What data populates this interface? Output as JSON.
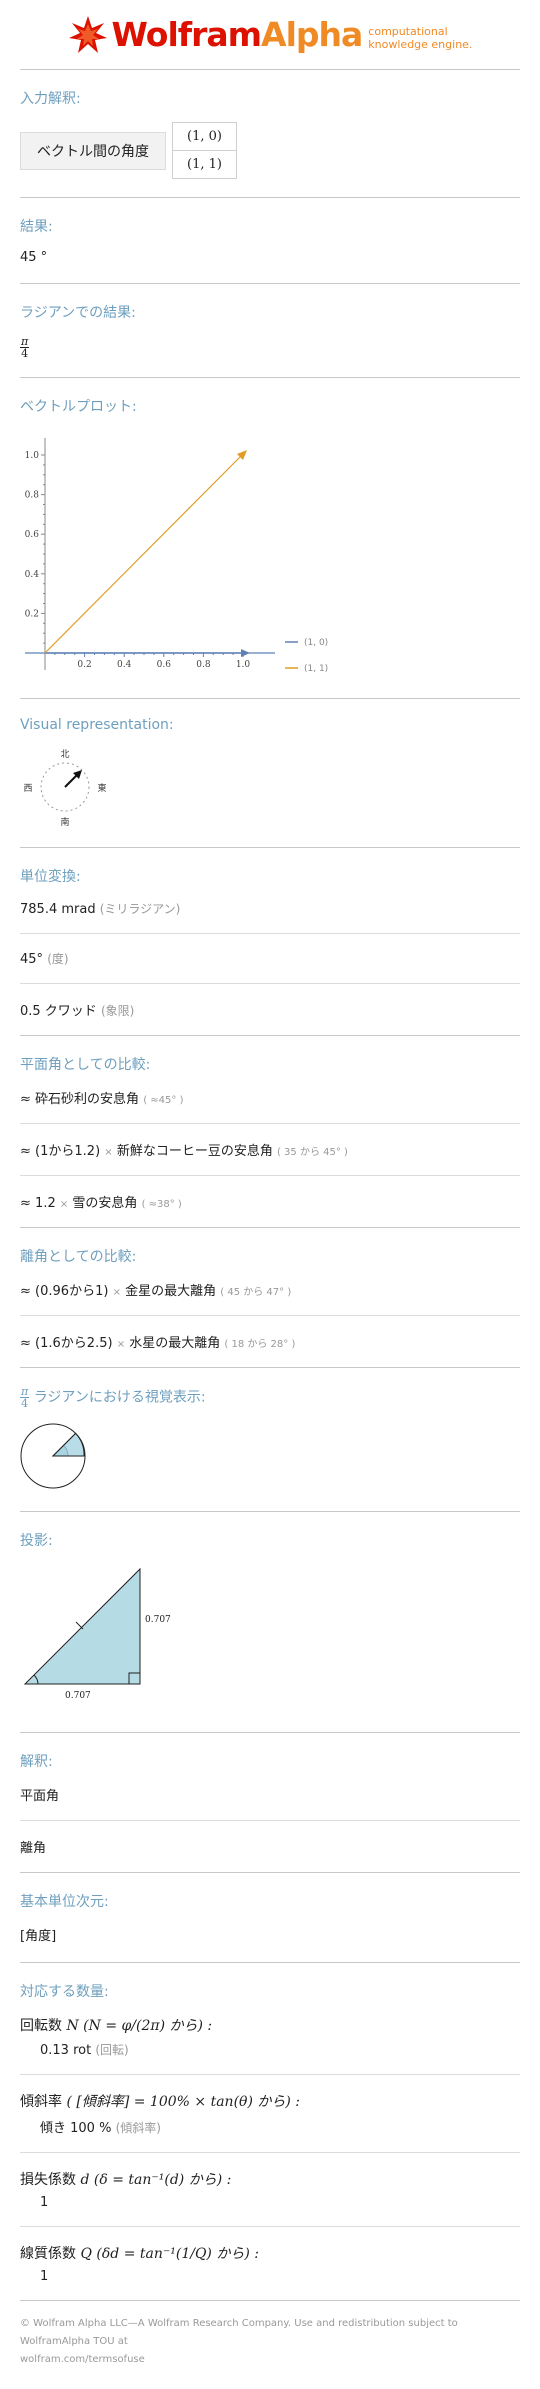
{
  "logo": {
    "word1": "Wolfram",
    "word2": "Alpha",
    "tagline1": "computational",
    "tagline2": "knowledge engine."
  },
  "input": {
    "title": "入力解釈:",
    "label": "ベクトル間の角度",
    "vec1": "(1, 0)",
    "vec2": "(1, 1)"
  },
  "result": {
    "title": "結果:",
    "value": "45 °"
  },
  "radian": {
    "title": "ラジアンでの結果:",
    "num": "π",
    "den": "4"
  },
  "plot": {
    "title": "ベクトルプロット:",
    "legend": [
      "(1, 0)",
      "(1, 1)"
    ],
    "colors": {
      "v1": "#5e81b5",
      "v2": "#e19c24"
    },
    "xticks": [
      "0.2",
      "0.4",
      "0.6",
      "0.8",
      "1.0"
    ],
    "yticks": [
      "0.2",
      "0.4",
      "0.6",
      "0.8",
      "1.0"
    ]
  },
  "visual": {
    "title": "Visual representation:",
    "north": "北",
    "south": "南",
    "east": "東",
    "west": "西"
  },
  "units": {
    "title": "単位変換:",
    "rows": [
      {
        "value": "785.4 mrad",
        "note": "(ミリラジアン)"
      },
      {
        "value": "45°",
        "note": "(度)"
      },
      {
        "value": "0.5 クワッド",
        "note": "(象限)"
      }
    ]
  },
  "planar": {
    "title": "平面角としての比較:",
    "r1": {
      "pre": "≈",
      "text": "砕石砂利の安息角",
      "note": "( ≈45° )"
    },
    "r2": {
      "pre": "≈",
      "range": "(1から1.2)",
      "times": "×",
      "text": "新鮮なコーヒー豆の安息角",
      "note": "( 35 から 45° )"
    },
    "r3": {
      "pre": "≈",
      "num": "1.2",
      "times": "×",
      "text": "雪の安息角",
      "note": "( ≈38° )"
    }
  },
  "elong": {
    "title": "離角としての比較:",
    "r1": {
      "pre": "≈",
      "range": "(0.96から1)",
      "times": "×",
      "text": "金星の最大離角",
      "note": "( 45 から 47° )"
    },
    "r2": {
      "pre": "≈",
      "range": "(1.6から2.5)",
      "times": "×",
      "text": "水星の最大離角",
      "note": "( 18 から 28° )"
    }
  },
  "radvis": {
    "num": "π",
    "den": "4",
    "title": "ラジアンにおける視覚表示:"
  },
  "projection": {
    "title": "投影:",
    "side1": "0.707",
    "side2": "0.707"
  },
  "interp": {
    "title": "解釈:",
    "items": [
      "平面角",
      "離角"
    ]
  },
  "basic": {
    "title": "基本単位次元:",
    "value": "[角度]"
  },
  "corr": {
    "title": "対応する数量:",
    "q1": {
      "label": "回転数",
      "var": "N",
      "formula": "(N = φ/(2π) から) :",
      "value": "0.13 rot",
      "note": "(回転)"
    },
    "q2": {
      "label": "傾斜率",
      "formula": "( [傾斜率] = 100% × tan(θ) から) :",
      "value": "傾き 100 %",
      "note": "(傾斜率)"
    },
    "q3": {
      "label": "損失係数",
      "var": "d",
      "formula": "(δ = tan⁻¹(d) から) :",
      "value": "1"
    },
    "q4": {
      "label": "線質係数",
      "var": "Q",
      "formula": "(δd = tan⁻¹(1/Q) から) :",
      "value": "1"
    }
  },
  "footer": {
    "line1": "© Wolfram Alpha LLC—A Wolfram Research Company. Use and redistribution subject to WolframAlpha TOU at",
    "line2": "wolfram.com/termsofuse"
  }
}
